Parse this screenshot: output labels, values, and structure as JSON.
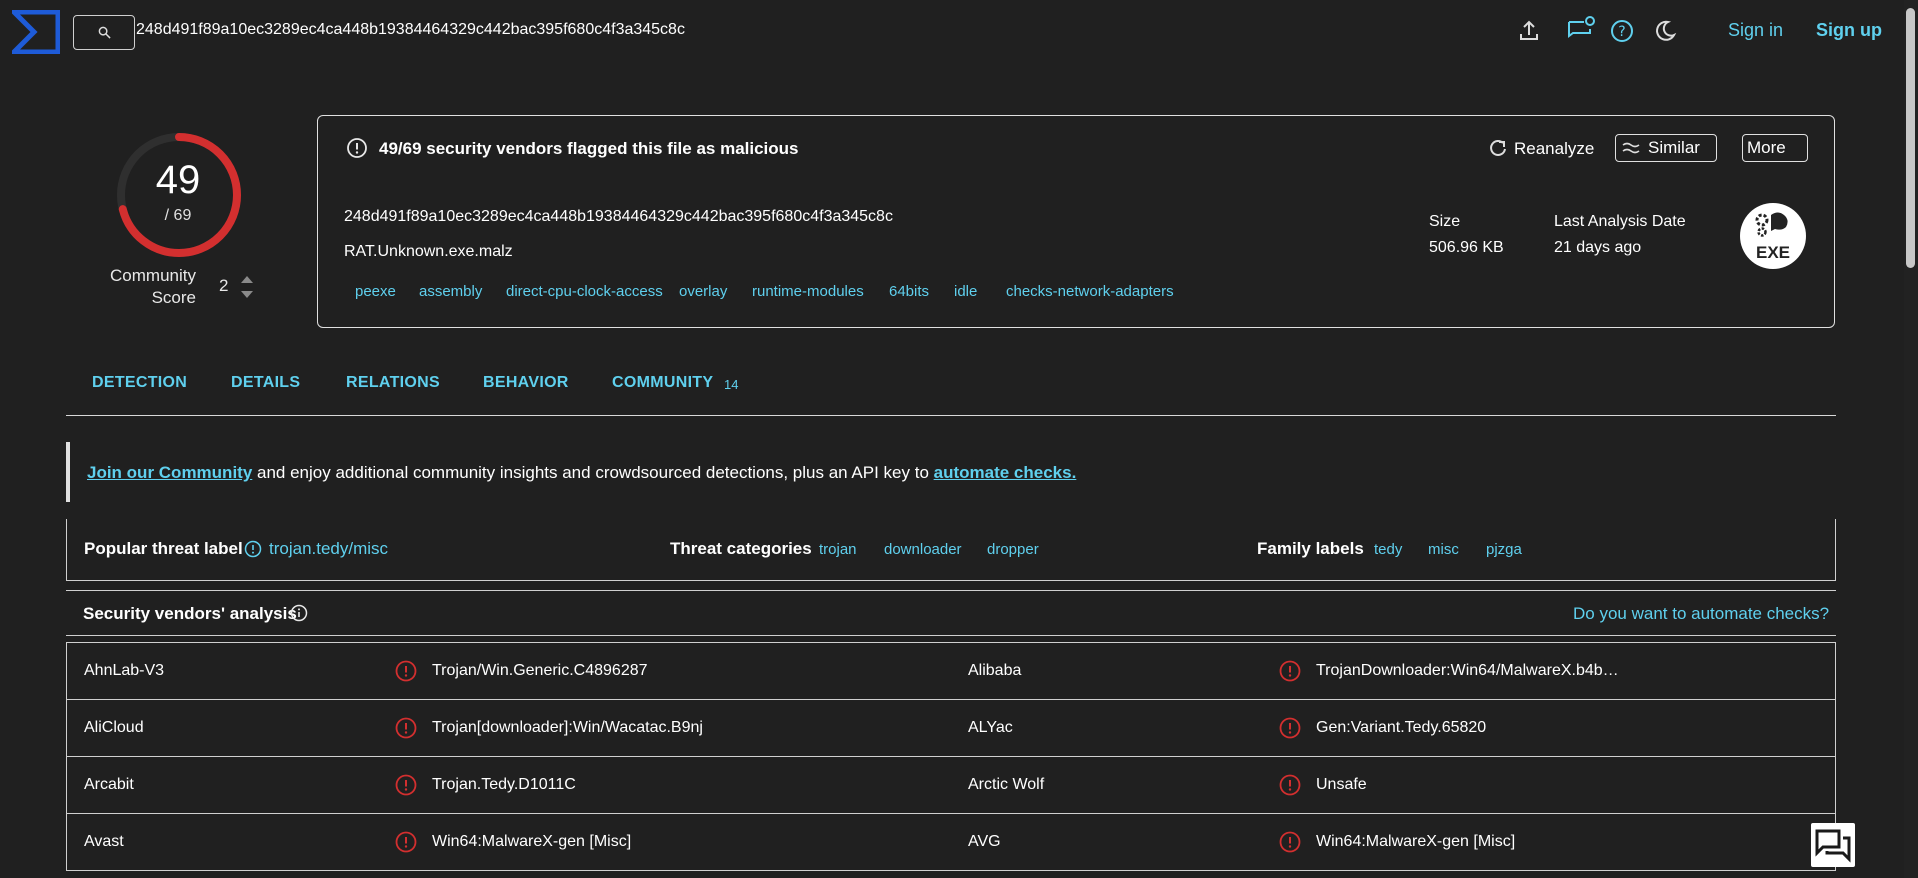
{
  "header": {
    "search_value": "248d491f89a10ec3289ec4ca448b19384464329c442bac395f680c4f3a345c8c",
    "sign_in": "Sign in",
    "sign_up": "Sign up",
    "icons": [
      "upload-icon",
      "chat-icon",
      "help-icon",
      "dark-mode-icon"
    ]
  },
  "score": {
    "value": "49",
    "total": "/ 69",
    "malicious_fraction": 0.71,
    "community_label": "Community Score",
    "community_value": "2"
  },
  "summary": {
    "flag_text": "49/69 security vendors flagged this file as malicious",
    "reanalyze": "Reanalyze",
    "similar": "Similar",
    "more": "More",
    "hash": "248d491f89a10ec3289ec4ca448b19384464329c442bac395f680c4f3a345c8c",
    "file_name": "RAT.Unknown.exe.malz",
    "tags": [
      "peexe",
      "assembly",
      "direct-cpu-clock-access",
      "overlay",
      "runtime-modules",
      "64bits",
      "idle",
      "checks-network-adapters"
    ],
    "size_label": "Size",
    "size_value": "506.96 KB",
    "last_analysis_label": "Last Analysis Date",
    "last_analysis_value": "21 days ago",
    "file_type": "EXE"
  },
  "tabs": [
    {
      "label": "DETECTION"
    },
    {
      "label": "DETAILS"
    },
    {
      "label": "RELATIONS"
    },
    {
      "label": "BEHAVIOR"
    },
    {
      "label": "COMMUNITY",
      "count": "14"
    }
  ],
  "banner": {
    "link1": "Join our Community",
    "middle": " and enjoy additional community insights and crowdsourced detections, plus an API key to ",
    "link2": "automate checks."
  },
  "labels": {
    "popular_head": "Popular threat label",
    "popular_value": "trojan.tedy/misc",
    "categories_head": "Threat categories",
    "categories": [
      "trojan",
      "downloader",
      "dropper"
    ],
    "family_head": "Family labels",
    "family": [
      "tedy",
      "misc",
      "pjzga"
    ]
  },
  "vendors": {
    "title": "Security vendors' analysis",
    "automate_link": "Do you want to automate checks?",
    "rows": [
      {
        "v1": "AhnLab-V3",
        "r1": "Trojan/Win.Generic.C4896287",
        "v2": "Alibaba",
        "r2": "TrojanDownloader:Win64/MalwareX.b4b…"
      },
      {
        "v1": "AliCloud",
        "r1": "Trojan[downloader]:Win/Wacatac.B9nj",
        "v2": "ALYac",
        "r2": "Gen:Variant.Tedy.65820"
      },
      {
        "v1": "Arcabit",
        "r1": "Trojan.Tedy.D1011C",
        "v2": "Arctic Wolf",
        "r2": "Unsafe"
      },
      {
        "v1": "Avast",
        "r1": "Win64:MalwareX-gen [Misc]",
        "v2": "AVG",
        "r2": "Win64:MalwareX-gen [Misc]"
      }
    ]
  },
  "colors": {
    "accent": "#5fd0ee",
    "malicious": "#d32f2f",
    "background": "#202020"
  }
}
